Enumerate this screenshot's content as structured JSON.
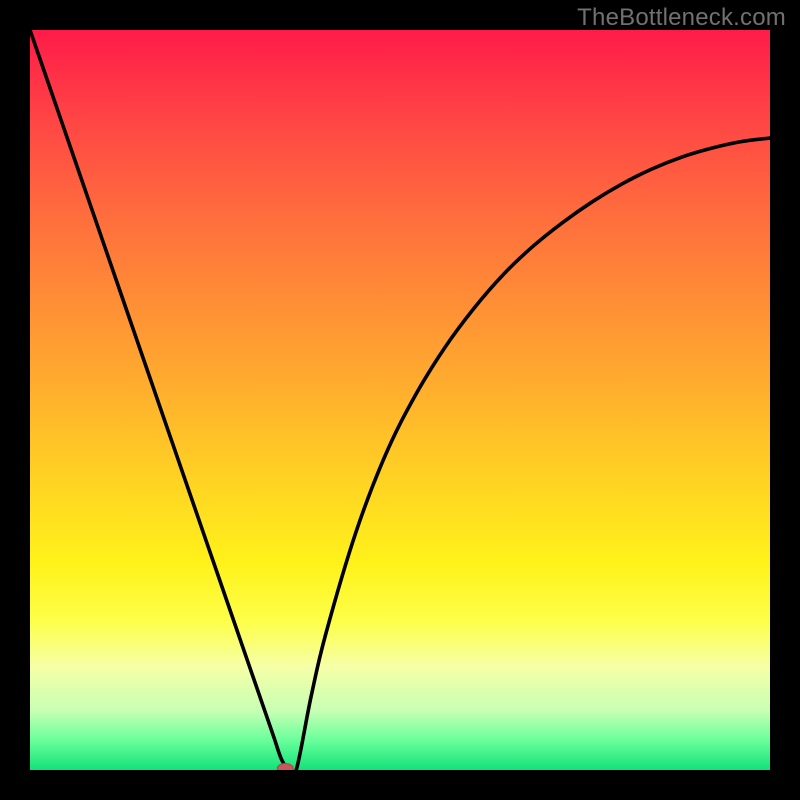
{
  "watermark": "TheBottleneck.com",
  "chart_data": {
    "type": "line",
    "title": "",
    "xlabel": "",
    "ylabel": "",
    "xlim": [
      0,
      100
    ],
    "ylim": [
      0,
      100
    ],
    "x": [
      0,
      4,
      8,
      12,
      16,
      20,
      24,
      28,
      30,
      32,
      33,
      34,
      35,
      36,
      38,
      40,
      44,
      48,
      52,
      56,
      60,
      64,
      68,
      72,
      76,
      80,
      84,
      88,
      92,
      96,
      100
    ],
    "y": [
      100,
      88.4,
      76.8,
      65.2,
      53.6,
      42.0,
      30.4,
      18.8,
      13.0,
      7.2,
      4.3,
      1.4,
      0.1,
      0.1,
      10.0,
      18.5,
      32.0,
      42.5,
      50.5,
      57.0,
      62.4,
      67.0,
      70.8,
      74.0,
      76.8,
      79.2,
      81.2,
      82.8,
      84.0,
      84.9,
      85.4
    ],
    "marker": {
      "x": 34.5,
      "y": 0.2,
      "shape": "pill",
      "color": "#c65a5a"
    },
    "grid": false,
    "legend": false,
    "background": {
      "type": "vertical-gradient",
      "stops": [
        {
          "pos": 0.0,
          "color": "#ff1b49"
        },
        {
          "pos": 0.12,
          "color": "#ff4545"
        },
        {
          "pos": 0.24,
          "color": "#ff6a3e"
        },
        {
          "pos": 0.36,
          "color": "#ff8c36"
        },
        {
          "pos": 0.48,
          "color": "#ffad2e"
        },
        {
          "pos": 0.6,
          "color": "#ffd024"
        },
        {
          "pos": 0.72,
          "color": "#fff21a"
        },
        {
          "pos": 0.8,
          "color": "#fdff4a"
        },
        {
          "pos": 0.86,
          "color": "#f6ffa6"
        },
        {
          "pos": 0.92,
          "color": "#c7ffb4"
        },
        {
          "pos": 0.96,
          "color": "#68ff9a"
        },
        {
          "pos": 1.0,
          "color": "#12e27a"
        }
      ]
    }
  }
}
